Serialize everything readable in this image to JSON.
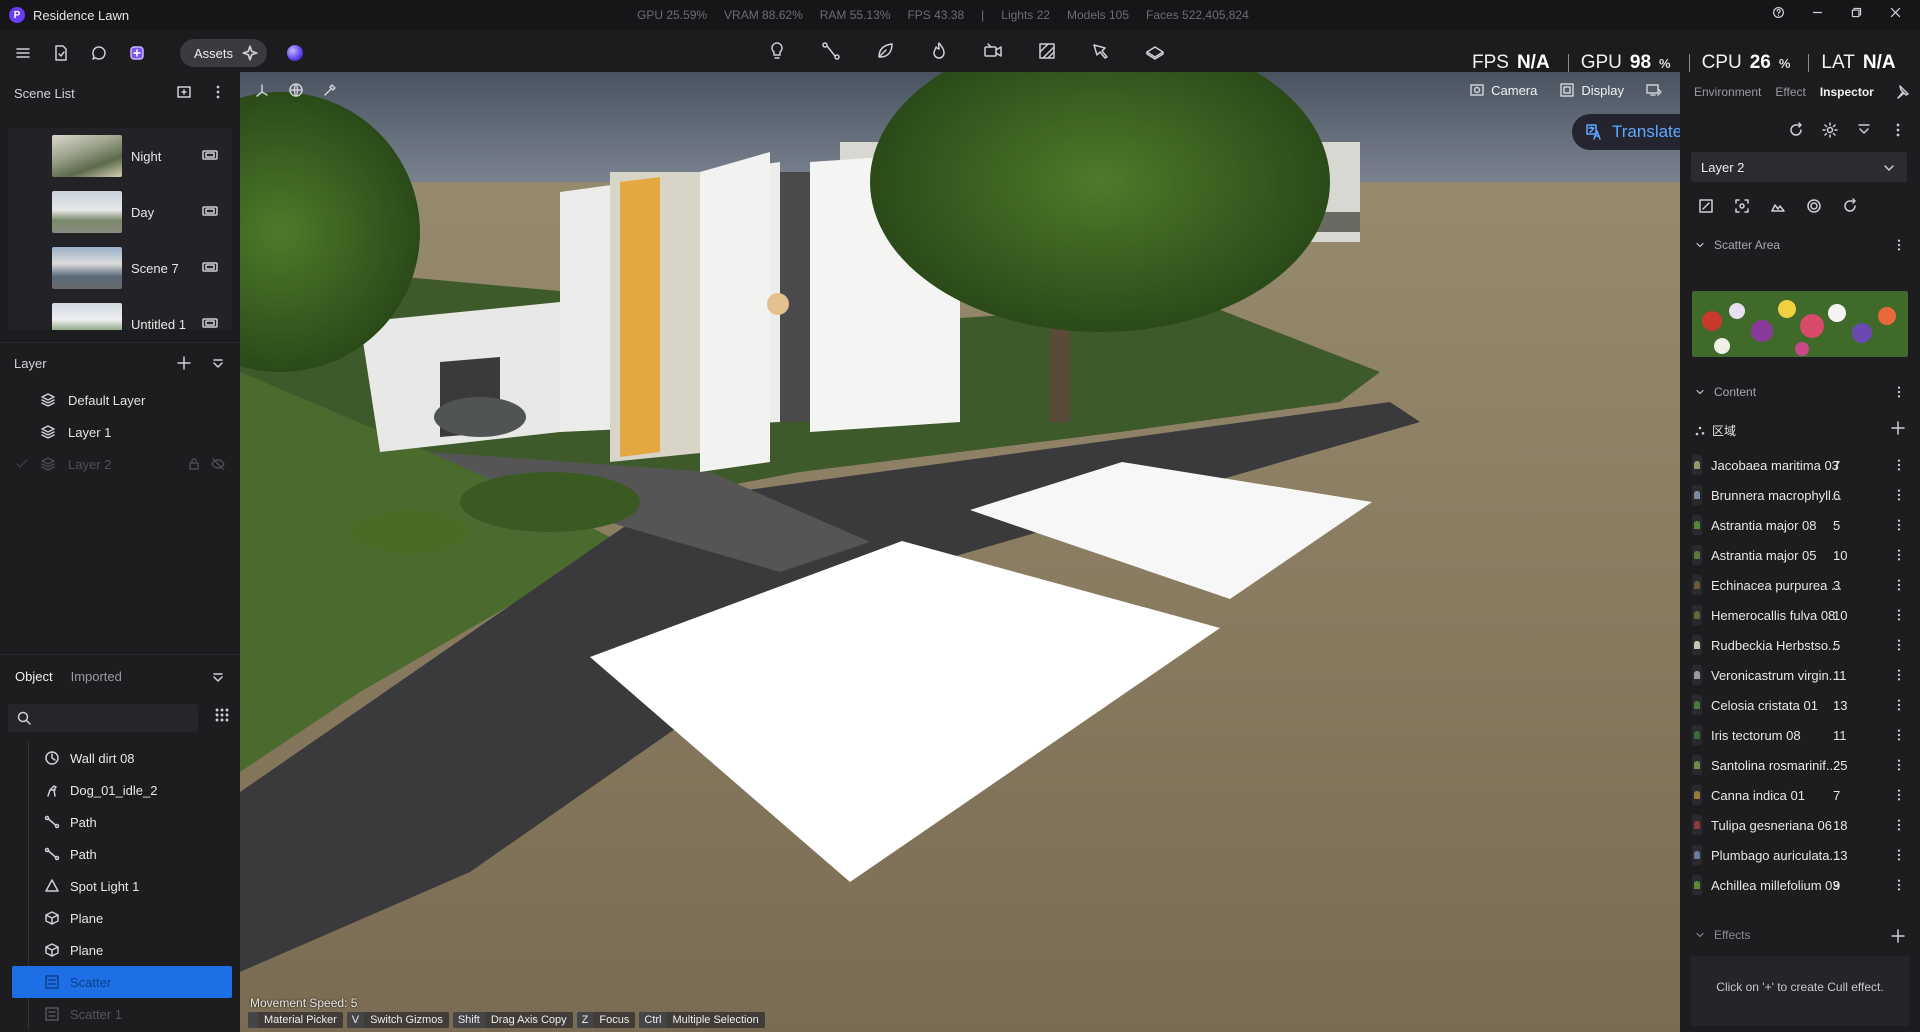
{
  "app": {
    "title": "Residence Lawn",
    "logo_letter": "P"
  },
  "stats": {
    "gpu": "GPU 25.59%",
    "vram": "VRAM 88.62%",
    "ram": "RAM 55.13%",
    "fps": "FPS 43.38",
    "sep": "|",
    "lights": "Lights 22",
    "models": "Models 105",
    "faces": "Faces 522,405,824"
  },
  "hud": {
    "fps_label": "FPS",
    "fps_value": "N/A",
    "gpu_label": "GPU",
    "gpu_value": "98",
    "gpu_unit": "%",
    "cpu_label": "CPU",
    "cpu_value": "26",
    "cpu_unit": "%",
    "lat_label": "LAT",
    "lat_value": "N/A"
  },
  "toolbar": {
    "assets_label": "Assets"
  },
  "scene_list": {
    "title": "Scene List",
    "items": [
      {
        "name": "Night"
      },
      {
        "name": "Day"
      },
      {
        "name": "Scene 7"
      },
      {
        "name": "Untitled 1"
      }
    ]
  },
  "layer_panel": {
    "title": "Layer",
    "items": [
      {
        "name": "Default Layer"
      },
      {
        "name": "Layer 1"
      },
      {
        "name": "Layer 2"
      }
    ]
  },
  "object_panel": {
    "tabs": [
      "Object",
      "Imported"
    ],
    "items": [
      {
        "name": "Wall dirt 08",
        "icon": "decal-icon"
      },
      {
        "name": "Dog_01_idle_2",
        "icon": "animal-icon"
      },
      {
        "name": "Path",
        "icon": "path-icon"
      },
      {
        "name": "Path",
        "icon": "path-icon"
      },
      {
        "name": "Spot Light 1",
        "icon": "spotlight-icon"
      },
      {
        "name": "Plane",
        "icon": "cube-icon"
      },
      {
        "name": "Plane",
        "icon": "cube-icon"
      },
      {
        "name": "Scatter",
        "icon": "scatter-icon"
      },
      {
        "name": "Scatter 1",
        "icon": "scatter-icon"
      }
    ]
  },
  "viewport": {
    "camera_label": "Camera",
    "display_label": "Display",
    "translate_label": "Translate to English",
    "movement_speed": "Movement Speed: 5",
    "shortcuts": [
      {
        "key": "",
        "label": "Material Picker"
      },
      {
        "key": "V",
        "label": "Switch Gizmos"
      },
      {
        "key": "Shift",
        "label": "Drag Axis Copy"
      },
      {
        "key": "Z",
        "label": "Focus"
      },
      {
        "key": "Ctrl",
        "label": "Multiple Selection"
      }
    ]
  },
  "inspector": {
    "tabs": [
      "Environment",
      "Effect",
      "Inspector"
    ],
    "layer_select": "Layer 2",
    "scatter_area_title": "Scatter Area",
    "content_title": "Content",
    "region_label": "区域",
    "plants": [
      {
        "name": "Jacobaea maritima 03",
        "count": "7",
        "color": "#8a9a6a"
      },
      {
        "name": "Brunnera macrophyll...",
        "count": "6",
        "color": "#7a8aa0"
      },
      {
        "name": "Astrantia major 08",
        "count": "5",
        "color": "#4f8a3a"
      },
      {
        "name": "Astrantia major 05",
        "count": "10",
        "color": "#5a7a3a"
      },
      {
        "name": "Echinacea purpurea ...",
        "count": "3",
        "color": "#6a5a3a"
      },
      {
        "name": "Hemerocallis fulva 08",
        "count": "10",
        "color": "#5a6a3a"
      },
      {
        "name": "Rudbeckia Herbstso...",
        "count": "5",
        "color": "#c8c8b0"
      },
      {
        "name": "Veronicastrum virgin...",
        "count": "11",
        "color": "#9a9aa0"
      },
      {
        "name": "Celosia cristata 01",
        "count": "13",
        "color": "#4a7a3a"
      },
      {
        "name": "Iris tectorum 08",
        "count": "11",
        "color": "#3a6a3a"
      },
      {
        "name": "Santolina rosmarinif...",
        "count": "25",
        "color": "#6a8a4a"
      },
      {
        "name": "Canna indica 01",
        "count": "7",
        "color": "#9a7a3a"
      },
      {
        "name": "Tulipa gesneriana 06",
        "count": "18",
        "color": "#8a3a3a"
      },
      {
        "name": "Plumbago auriculata...",
        "count": "13",
        "color": "#6a7a9a"
      },
      {
        "name": "Achillea millefolium 03",
        "count": "9",
        "color": "#5a8a3a"
      }
    ],
    "effects_title": "Effects",
    "effects_hint": "Click on '+' to create Cull effect."
  },
  "colors": {
    "accent": "#1e6fe6",
    "brand": "#6b3cf5",
    "link": "#5da8ff"
  }
}
